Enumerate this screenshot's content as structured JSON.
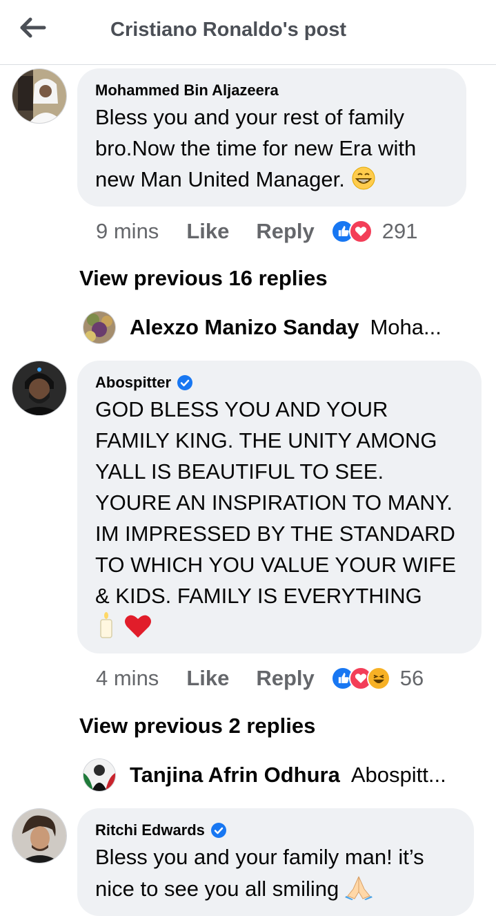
{
  "header": {
    "title": "Cristiano Ronaldo's post"
  },
  "comments": [
    {
      "author": "Mohammed Bin Aljazeera",
      "text": "Bless you and your rest of family bro.Now the time for new Era with new Man United Manager.",
      "time": "9 mins",
      "like": "Like",
      "reply": "Reply",
      "reaction_count": "291",
      "reactions": [
        "like-icon",
        "love-icon"
      ],
      "verified": false
    },
    {
      "author": "Abospitter",
      "text": "GOD BLESS YOU AND YOUR FAMILY KING. THE UNITY AMONG YALL IS BEAUTIFUL TO SEE. YOURE AN INSPIRATION TO MANY. IM IMPRESSED BY THE STANDARD TO WHICH YOU VALUE YOUR WIFE & KIDS. FAMILY IS EVERYTHING",
      "time": "4 mins",
      "like": "Like",
      "reply": "Reply",
      "reaction_count": "56",
      "reactions": [
        "like-icon",
        "love-icon",
        "haha-icon"
      ],
      "verified": true
    },
    {
      "author": "Ritchi Edwards",
      "text": "Bless you and your family man! it’s nice to see you all smiling",
      "verified": true
    }
  ],
  "reply_groups": [
    {
      "view_previous": "View previous 16 replies",
      "author": "Alexzo Manizo Sanday",
      "preview": "Moha..."
    },
    {
      "view_previous": "View previous 2 replies",
      "author": "Tanjina Afrin Odhura",
      "preview": "Abospitt..."
    }
  ],
  "colors": {
    "like_blue": "#1877f2",
    "love_red": "#f33e58",
    "verified_blue": "#1877f2",
    "bubble_bg": "#eff1f4"
  }
}
